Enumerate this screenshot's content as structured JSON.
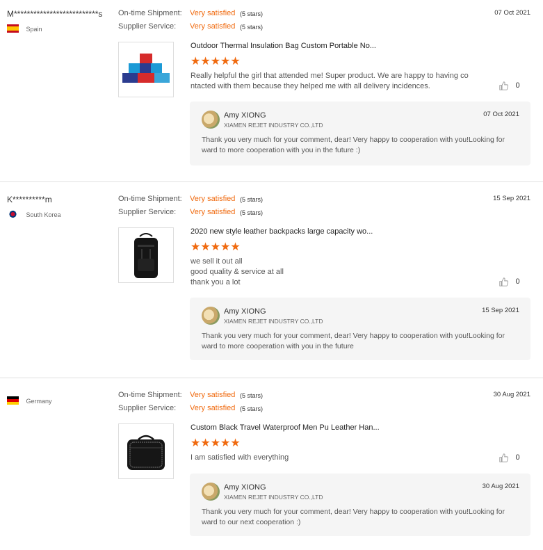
{
  "reviews": [
    {
      "user": "M**************************s",
      "country": "Spain",
      "date": "07 Oct 2021",
      "shipment_label": "On-time Shipment:",
      "shipment_value": "Very satisfied",
      "shipment_stars": "(5 stars)",
      "service_label": "Supplier Service:",
      "service_value": "Very satisfied",
      "service_stars": "(5 stars)",
      "product_title": "Outdoor Thermal Insulation Bag Custom Portable No...",
      "rating": "★★★★★",
      "text": "Really helpful the girl that attended me! Super product. We are happy to having co\nntacted with them because they helped me with all delivery incidences.",
      "likes": "0",
      "reply": {
        "name": "Amy XIONG",
        "company": "XIAMEN REJET INDUSTRY CO.,LTD",
        "date": "07 Oct 2021",
        "text": "Thank you very much for your comment, dear! Very happy to cooperation with you!Looking for ward to more cooperation with you in the future :)"
      }
    },
    {
      "user": "K**********m",
      "country": "South Korea",
      "date": "15 Sep 2021",
      "shipment_label": "On-time Shipment:",
      "shipment_value": "Very satisfied",
      "shipment_stars": "(5 stars)",
      "service_label": "Supplier Service:",
      "service_value": "Very satisfied",
      "service_stars": "(5 stars)",
      "product_title": "2020 new style leather backpacks large capacity wo...",
      "rating": "★★★★★",
      "text": "we sell it out all\ngood quality & service at all\nthank you a lot",
      "likes": "0",
      "reply": {
        "name": "Amy XIONG",
        "company": "XIAMEN REJET INDUSTRY CO.,LTD",
        "date": "15 Sep 2021",
        "text": "Thank you very much for your comment, dear! Very happy to cooperation with you!Looking for ward to more cooperation with you in the future"
      }
    },
    {
      "user": "",
      "country": "Germany",
      "date": "30 Aug 2021",
      "shipment_label": "On-time Shipment:",
      "shipment_value": "Very satisfied",
      "shipment_stars": "(5 stars)",
      "service_label": "Supplier Service:",
      "service_value": "Very satisfied",
      "service_stars": "(5 stars)",
      "product_title": "Custom Black Travel Waterproof Men Pu Leather Han...",
      "rating": "★★★★★",
      "text": "I am satisfied with everything",
      "likes": "0",
      "reply": {
        "name": "Amy XIONG",
        "company": "XIAMEN REJET INDUSTRY CO.,LTD",
        "date": "30 Aug 2021",
        "text": "Thank you very much for your comment, dear! Very happy to cooperation with you!Looking for ward to our next cooperation :)"
      }
    }
  ],
  "colors": {
    "accent": "#f06a0f",
    "reply_bg": "#f5f5f5"
  },
  "icons": {
    "like": "thumbs-up-icon"
  }
}
